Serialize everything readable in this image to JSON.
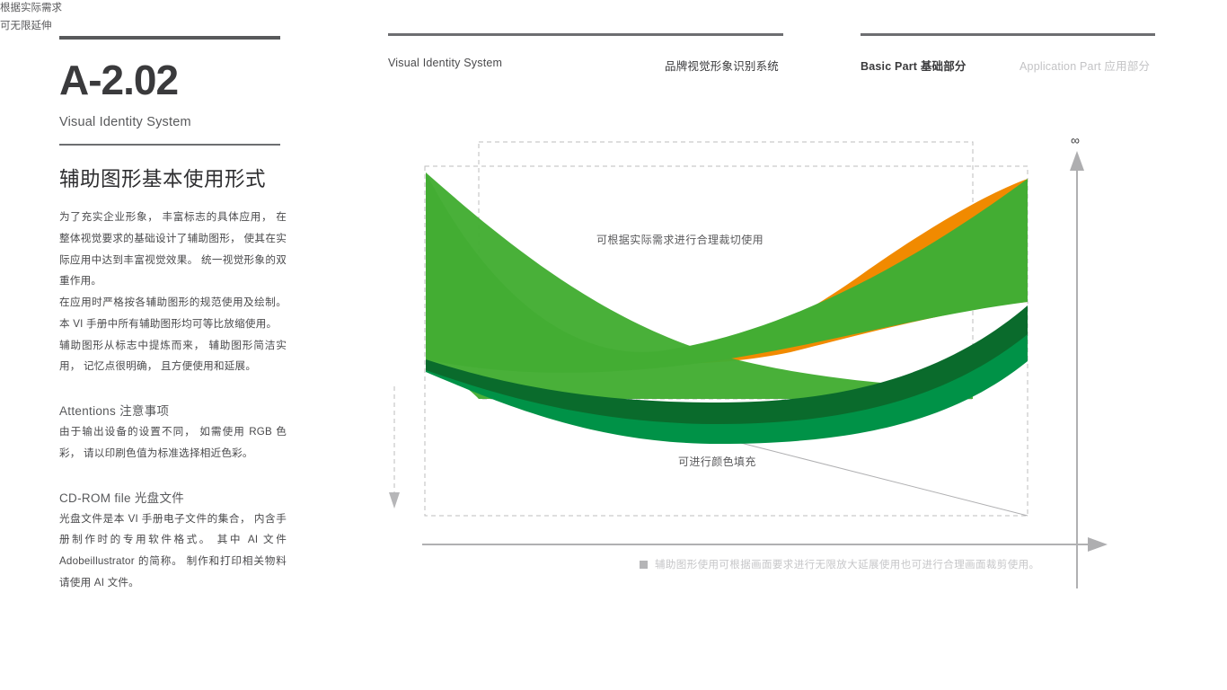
{
  "left": {
    "code": "A-2.02",
    "code_subtitle": "Visual Identity System",
    "section_title": "辅助图形基本使用形式",
    "paragraphs": [
      "为了充实企业形象， 丰富标志的具体应用， 在整体视觉要求的基础设计了辅助图形， 使其在实际应用中达到丰富视觉效果。 统一视觉形象的双重作用。",
      "在应用时严格按各辅助图形的规范使用及绘制。 本 VI 手册中所有辅助图形均可等比放缩使用。",
      "辅助图形从标志中提炼而来， 辅助图形简洁实用， 记忆点很明确， 且方便使用和延展。"
    ],
    "attentions": {
      "heading": "Attentions 注意事项",
      "body": "由于输出设备的设置不同， 如需使用 RGB 色彩， 请以印刷色值为标准选择相近色彩。"
    },
    "cdrom": {
      "heading": "CD-ROM file 光盘文件",
      "body": "光盘文件是本 VI 手册电子文件的集合， 内含手册制作时的专用软件格式。 其中 AI 文件 Adobeillustrator 的简称。 制作和打印相关物料请使用 AI 文件。"
    }
  },
  "nav": {
    "item_en": "Visual Identity System",
    "item_cn": "品牌视觉形象识别系统",
    "basic_part": "Basic Part 基础部分",
    "application_part": "Application Part 应用部分"
  },
  "graphic": {
    "annotation_crop": "可根据实际需求进行合理裁切使用",
    "annotation_fill": "可进行颜色填充",
    "axis_label_line1": "根据实际需求",
    "axis_label_line2": "可无限延伸",
    "infinity_symbol": "∞",
    "footnote": "辅助图形使用可根据画面要求进行无限放大延展使用也可进行合理画面裁剪使用。"
  },
  "colors": {
    "light_green": "#43ad33",
    "mid_green": "#009247",
    "dark_green": "#0a6b2c",
    "orange": "#f18a00",
    "rule_dark": "#6d6e71",
    "text_dark": "#3a3a3c",
    "text_body": "#4a4a4c",
    "text_muted": "#c3c3c5",
    "guide_dash": "#b8b8ba"
  }
}
